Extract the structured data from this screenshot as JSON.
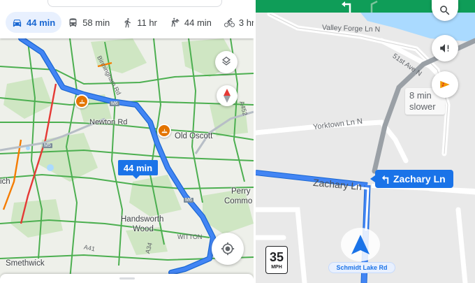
{
  "left_panel": {
    "modes": [
      {
        "icon": "car-icon",
        "label": "44 min",
        "active": true
      },
      {
        "icon": "bus-icon",
        "label": "58 min",
        "active": false
      },
      {
        "icon": "walk-icon",
        "label": "11 hr",
        "active": false
      },
      {
        "icon": "rideshare-icon",
        "label": "44 min",
        "active": false
      },
      {
        "icon": "bike-icon",
        "label": "3 hr",
        "active": false
      }
    ],
    "places": {
      "old_oscott": "Old Oscott",
      "newton_rd": "Newton Rd",
      "perry": "Perry",
      "commo": "Commo",
      "handsworth": "Handsworth",
      "wood": "Wood",
      "smethwick": "Smethwick",
      "ich": "ich",
      "witton": "WITTON",
      "birmingham_rd": "Birmingham Rd"
    },
    "road_shields": {
      "m6_top": "M6",
      "m5": "M5",
      "m6_bottom": "M6",
      "a41": "A41",
      "a34": "A34",
      "a452": "A452"
    },
    "duration_label": "44 min",
    "colors": {
      "route": "#4285f4",
      "active_mode": "#1967d2",
      "incident": "#e37400"
    }
  },
  "right_panel": {
    "streets": {
      "valley_forge": "Valley Forge Ln N",
      "fifty_first": "51st Ave N",
      "yorktown": "Yorktown Ln N",
      "zachary": "Zachary Ln"
    },
    "slower": {
      "line1": "8 min",
      "line2": "slower"
    },
    "turn_chip": "Zachary Ln",
    "speed_limit": {
      "value": "35",
      "unit": "MPH"
    },
    "current_street": "Schmidt Lake Rd",
    "colors": {
      "nav_bar": "#0f9d58",
      "route": "#4285f4",
      "alt_route": "#9aa0a6"
    }
  }
}
